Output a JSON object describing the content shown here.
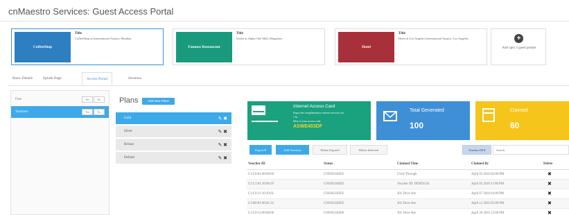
{
  "app": {
    "title": "cnMaestro Services: Guest Access Portal"
  },
  "colors": {
    "coffeeshop": "#2d7fc1",
    "restaurant": "#1a9a7c",
    "hotel": "#a8303a",
    "accent": "#3ea9e8",
    "card_green": "#1aa17e",
    "card_blue": "#3f8fd6",
    "card_yellow": "#f5c51c"
  },
  "portals": [
    {
      "thumb_label": "CoffeeShop",
      "title": "Title",
      "desc": "CoffeeShop at International Airport, Mumbai"
    },
    {
      "thumb_label": "Famous Restaurant",
      "title": "Title",
      "desc": "Outlet at Alpha One Mall, Bangalore"
    },
    {
      "thumb_label": "Hotel",
      "title": "Title",
      "desc": "Hotel at Los Angeles International Airport, Los Angeles"
    }
  ],
  "add_portal": {
    "icon": "plus-circle-icon",
    "label": "Add upto 3 guest portals"
  },
  "tabs": [
    "Basic Details",
    "Splash Page",
    "Access Portal",
    "Sessions"
  ],
  "active_tab": "Access Portal",
  "access_types": [
    {
      "label": "Free",
      "yes": "Yes",
      "no": "No"
    },
    {
      "label": "Vouchers",
      "yes": "Yes",
      "no": "No"
    }
  ],
  "plans": {
    "heading": "Plans",
    "add_button": "Add New Plans",
    "items": [
      "Gold",
      "Silver",
      "Bronze",
      "Default"
    ]
  },
  "card": {
    "title": "Internet Access Card",
    "line1": "Enjoy the complimentary internet services for",
    "line2": "1 hr",
    "line3": "Here is your access code",
    "code": "ASWE453DF"
  },
  "stats": [
    {
      "label": "Total Generated",
      "value": "100",
      "icon": "envelope-icon"
    },
    {
      "label": "Claimed",
      "value": "60",
      "icon": "inbox-icon"
    }
  ],
  "toolbar": {
    "export": "Export ▾",
    "add": "Add Vouchers",
    "delete_expired": "Delete Expired",
    "delete_selected": "Delete Selected",
    "filter": "Voucher ID",
    "search_placeholder": "Search"
  },
  "table": {
    "headers": [
      "Voucher ID",
      "Status",
      "Claimed Time",
      "Claimed By",
      "Delete"
    ],
    "rows": [
      [
        "C1:C0:01:00:00:66",
        "CNSNGSSID2",
        "Click-Through",
        "April 02 2016 02:00 PM"
      ],
      [
        "C1:C1:01:10:00:29",
        "CNSNGSSID2",
        "Voucher ID: DERT4534",
        "April 05 2016 11:00 PM"
      ],
      [
        "C1:C0:11:10:10:61",
        "CNSNGSSID5",
        "301 Dove Ave",
        "April 07 2016 03:00 PM"
      ],
      [
        "C1:B0:01:00:01:33",
        "CNSNGSSID5",
        "301 Dove Ave",
        "April 12 2016 05:00 PM"
      ],
      [
        "C1:C0:13:00:00:06",
        "CNSNGSSID6",
        "301 Dove Ave",
        "April 20 2016 12:00 PM"
      ]
    ]
  }
}
